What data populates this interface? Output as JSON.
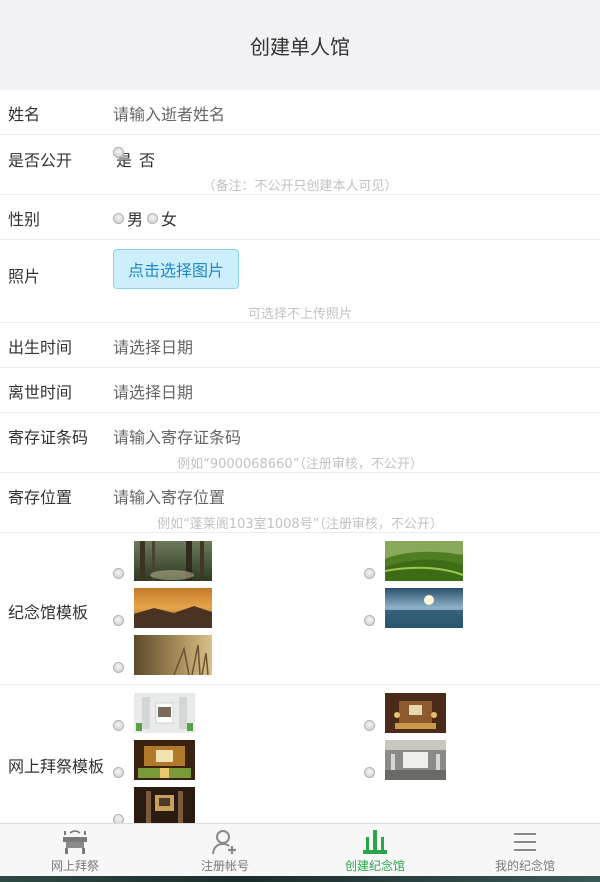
{
  "header": {
    "title": "创建单人馆"
  },
  "form": {
    "name": {
      "label": "姓名",
      "placeholder": "请输入逝者姓名"
    },
    "public": {
      "label": "是否公开",
      "options": [
        "是",
        "否"
      ],
      "note": "（备注：不公开只创建本人可见）"
    },
    "gender": {
      "label": "性别",
      "options": [
        "男",
        "女"
      ]
    },
    "photo": {
      "label": "照片",
      "button": "点击选择图片",
      "note": "可选择不上传照片"
    },
    "birth": {
      "label": "出生时间",
      "placeholder": "请选择日期"
    },
    "death": {
      "label": "离世时间",
      "placeholder": "请选择日期"
    },
    "cert": {
      "label": "寄存证条码",
      "placeholder": "请输入寄存证条码",
      "note": "例如“9000068660”（注册审核，不公开）"
    },
    "location": {
      "label": "寄存位置",
      "placeholder": "请输入寄存位置",
      "note": "例如“蓬莱阁103室1008号”（注册审核，不公开）"
    },
    "memorial_template": {
      "label": "纪念馆模板"
    },
    "worship_template": {
      "label": "网上拜祭模板"
    }
  },
  "tabbar": {
    "items": [
      {
        "label": "网上拜祭",
        "icon": "altar-icon"
      },
      {
        "label": "注册帐号",
        "icon": "user-add-icon"
      },
      {
        "label": "创建纪念馆",
        "icon": "memorial-icon",
        "active": true
      },
      {
        "label": "我的纪念馆",
        "icon": "menu-icon"
      }
    ],
    "active_color": "#2aa54a"
  }
}
